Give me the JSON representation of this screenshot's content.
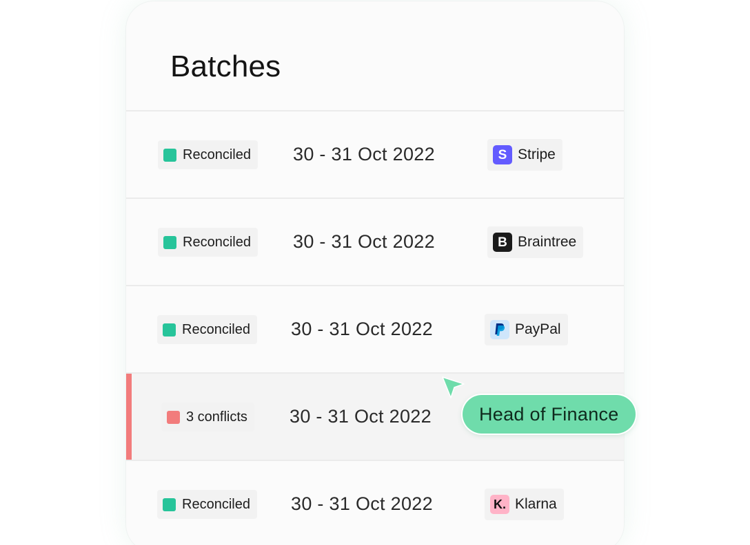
{
  "header": {
    "title": "Batches"
  },
  "batches": [
    {
      "status": "Reconciled",
      "status_type": "ok",
      "date_range": "30 - 31 Oct 2022",
      "provider": {
        "name": "Stripe",
        "icon": "stripe-logo-icon",
        "logo_glyph": "S"
      }
    },
    {
      "status": "Reconciled",
      "status_type": "ok",
      "date_range": "30 - 31 Oct 2022",
      "provider": {
        "name": "Braintree",
        "icon": "braintree-logo-icon",
        "logo_glyph": "B"
      }
    },
    {
      "status": "Reconciled",
      "status_type": "ok",
      "date_range": "30 - 31 Oct 2022",
      "provider": {
        "name": "PayPal",
        "icon": "paypal-logo-icon",
        "logo_glyph": ""
      }
    },
    {
      "status": "3 conflicts",
      "status_type": "conflict",
      "date_range": "30 - 31 Oct 2022",
      "provider": null
    },
    {
      "status": "Reconciled",
      "status_type": "ok",
      "date_range": "30 - 31 Oct 2022",
      "provider": {
        "name": "Klarna",
        "icon": "klarna-logo-icon",
        "logo_glyph": "K."
      }
    }
  ],
  "cursor_tag": {
    "label": "Head of Finance",
    "icon": "pointer-cursor-icon"
  },
  "colors": {
    "reconciled": "#27c49a",
    "conflict": "#f27c7c",
    "tag": "#6fdcab",
    "stripe": "#635bff",
    "braintree": "#1b1b1b",
    "paypal": "#cfe6fb",
    "klarna": "#ffb3c7"
  }
}
